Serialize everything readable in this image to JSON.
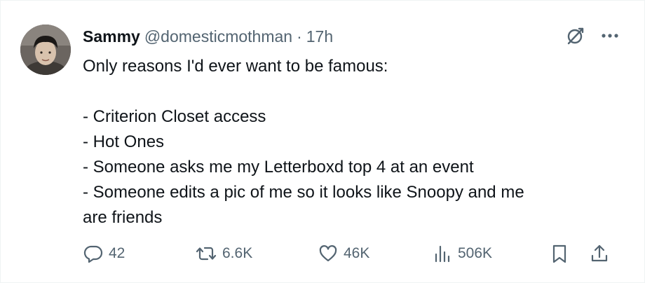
{
  "author": {
    "name": "Sammy",
    "handle": "@domesticmothman",
    "separator": "·",
    "time": "17h"
  },
  "post": {
    "intro": "Only reasons I'd ever want to be famous:",
    "items": [
      "- Criterion Closet access",
      "- Hot Ones",
      "- Someone asks me my Letterboxd top 4 at an event",
      "- Someone edits a pic of me so it looks like Snoopy and me",
      "are friends"
    ]
  },
  "metrics": {
    "replies": "42",
    "reposts": "6.6K",
    "likes": "46K",
    "views": "506K"
  },
  "icons": {
    "top": [
      "grok-icon",
      "more-icon"
    ],
    "actions": [
      "reply-icon",
      "repost-icon",
      "like-icon",
      "views-icon",
      "bookmark-icon",
      "share-icon"
    ]
  },
  "colors": {
    "text": "#0f1419",
    "secondary": "#536471",
    "border": "#eff3f4"
  }
}
